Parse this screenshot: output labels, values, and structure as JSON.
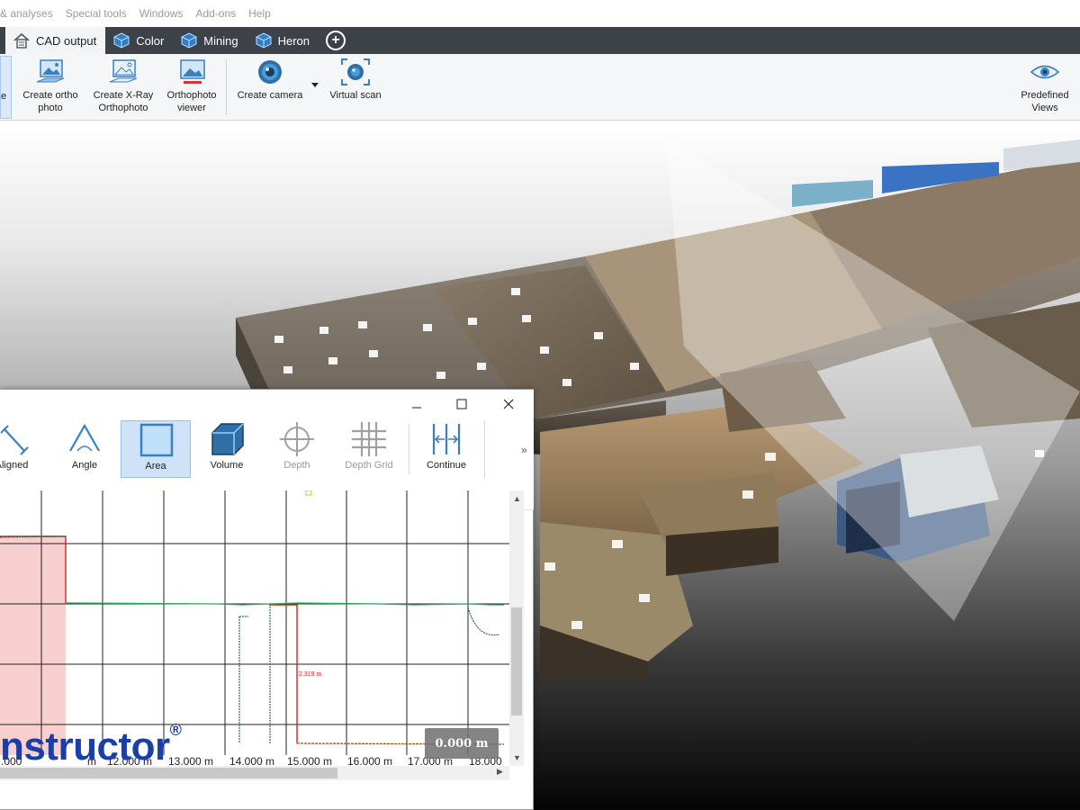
{
  "menu": [
    "& analyses",
    "Special tools",
    "Windows",
    "Add-ons",
    "Help"
  ],
  "tabs": [
    {
      "label": "CAD output",
      "icon": "cad-house-icon",
      "active": true
    },
    {
      "label": "Color",
      "icon": "cube-icon",
      "active": false
    },
    {
      "label": "Mining",
      "icon": "cube-icon",
      "active": false
    },
    {
      "label": "Heron",
      "icon": "cube-icon",
      "active": false
    }
  ],
  "ribbon": {
    "create_ortho_photo": "Create ortho\nphoto",
    "create_xray_orthophoto": "Create X-Ray\nOrthophoto",
    "orthophoto_viewer": "Orthophoto\nviewer",
    "create_camera": "Create camera",
    "virtual_scan": "Virtual scan",
    "predefined_views": "Predefined\nViews",
    "partial_left_label": "e"
  },
  "measure_window": {
    "tools": [
      {
        "label": "Aligned",
        "icon": "aligned-measure-icon",
        "state": "normal"
      },
      {
        "label": "Angle",
        "icon": "angle-icon",
        "state": "normal"
      },
      {
        "label": "Area",
        "icon": "area-icon",
        "state": "selected"
      },
      {
        "label": "Volume",
        "icon": "volume-cube-icon",
        "state": "normal"
      },
      {
        "label": "Depth",
        "icon": "depth-crosshair-icon",
        "state": "disabled"
      },
      {
        "label": "Depth Grid",
        "icon": "depth-grid-icon",
        "state": "disabled"
      },
      {
        "label": "Continue",
        "icon": "continue-icon",
        "state": "normal"
      }
    ],
    "more": "»",
    "x_axis_labels": [
      ".000",
      "m",
      "12.000 m",
      "13.000 m",
      "14.000 m",
      "15.000 m",
      "16.000 m",
      "17.000 m",
      "18.000"
    ],
    "dimension_label": "2.319 m",
    "readout": "0.000 m",
    "brand": "nstructor",
    "brand_mark": "®"
  },
  "colors": {
    "tabbar": "#3d4248",
    "brand": "#1a3fa8",
    "selection": "#cfe3f8",
    "measure_red": "#e02020"
  }
}
